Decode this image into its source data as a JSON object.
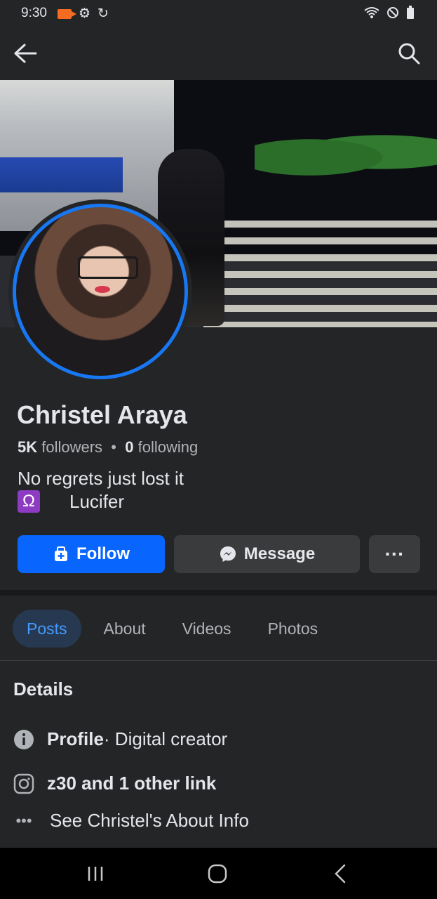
{
  "status_bar": {
    "time": "9:30"
  },
  "profile": {
    "name": "Christel Araya",
    "followers_count": "5K",
    "followers_label": "followers",
    "separator": "•",
    "following_count": "0",
    "following_label": "following",
    "bio_line1": "No regrets just lost it",
    "bio_emoji": "Ω",
    "bio_line2": "Lucifer"
  },
  "actions": {
    "follow_label": "Follow",
    "message_label": "Message",
    "more_label": "···"
  },
  "tabs": [
    {
      "label": "Posts",
      "active": true
    },
    {
      "label": "About",
      "active": false
    },
    {
      "label": "Videos",
      "active": false
    },
    {
      "label": "Photos",
      "active": false
    }
  ],
  "details": {
    "title": "Details",
    "profile_label": "Profile",
    "profile_value": " · Digital creator",
    "links_label": "z30 and 1 other link",
    "about_label": "See Christel's About Info"
  },
  "icons": {
    "back": "arrow-left-icon",
    "search": "search-icon",
    "follow": "add-friend-icon",
    "message": "messenger-icon",
    "info": "info-icon",
    "instagram": "instagram-icon",
    "more": "ellipsis-icon"
  },
  "colors": {
    "accent": "#0866ff",
    "ring": "#1877f2",
    "background": "#242526",
    "active_tab_bg": "#263951",
    "active_tab_text": "#4599ff"
  }
}
